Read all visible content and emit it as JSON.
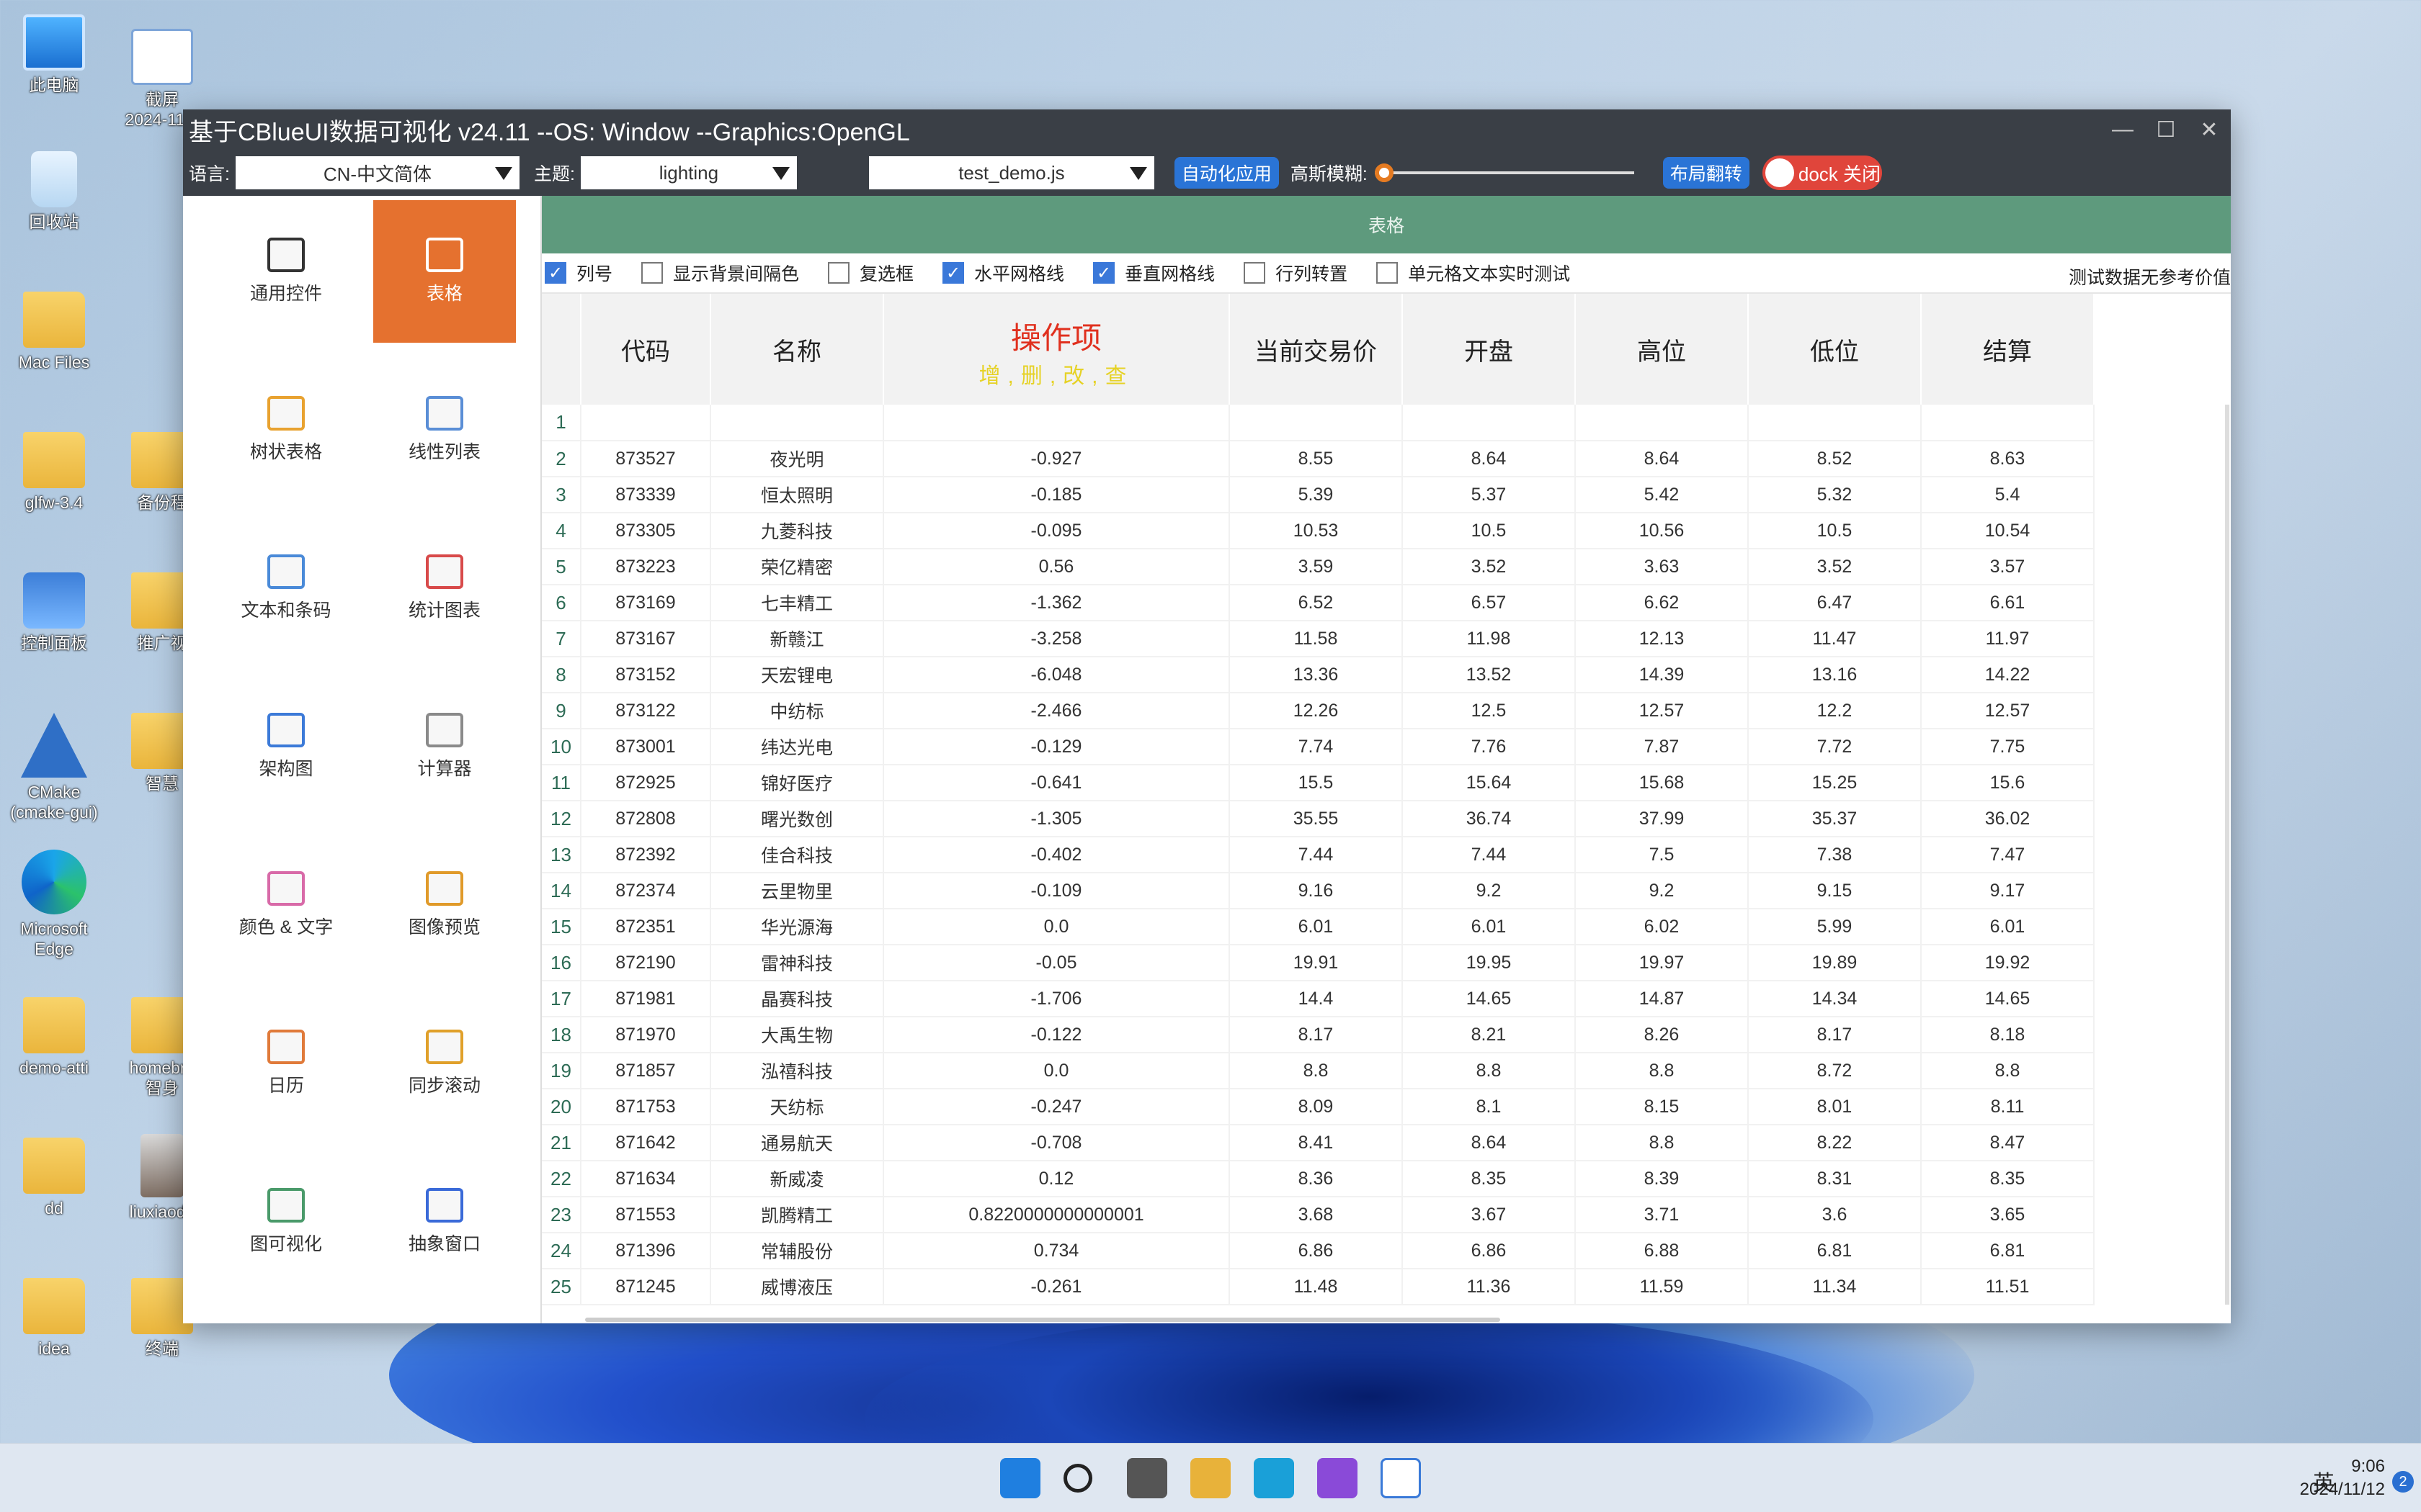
{
  "desktop": {
    "icons": [
      {
        "label": "此电脑",
        "kind": "pc"
      },
      {
        "label": "截屏\n2024-11-1",
        "kind": "shot"
      },
      {
        "label": "回收站",
        "kind": "bin"
      },
      {
        "label": "Mac Files",
        "kind": "folder"
      },
      {
        "label": "glfw-3.4",
        "kind": "folder"
      },
      {
        "label": "备份程",
        "kind": "folder"
      },
      {
        "label": "控制面板",
        "kind": "panel"
      },
      {
        "label": "推广视",
        "kind": "folder"
      },
      {
        "label": "CMake\n(cmake-gui)",
        "kind": "cmake"
      },
      {
        "label": "智慧",
        "kind": "folder"
      },
      {
        "label": "Microsoft\nEdge",
        "kind": "edge"
      },
      {
        "label": "demo-atti",
        "kind": "folder"
      },
      {
        "label": "homebre\n智身",
        "kind": "folder"
      },
      {
        "label": "dd",
        "kind": "folder"
      },
      {
        "label": "liuxiaodo",
        "kind": "photo"
      },
      {
        "label": "idea",
        "kind": "folder"
      },
      {
        "label": "终端",
        "kind": "folder"
      }
    ]
  },
  "window": {
    "title": "基于CBlueUI数据可视化 v24.11  --OS: Window  --Graphics:OpenGL",
    "controls": {
      "min": "—",
      "max": "☐",
      "close": "✕"
    }
  },
  "toolbar": {
    "lang_label": "语言:",
    "lang_value": "CN-中文简体",
    "theme_label": "主题:",
    "theme_value": "lighting",
    "script_value": "test_demo.js",
    "auto_apply": "自动化应用",
    "blur_label": "高斯模糊:",
    "blur_level": 0,
    "layout_flip": "布局翻转",
    "dock_label": "dock 关闭"
  },
  "sidebar": {
    "items": [
      {
        "label": "通用控件",
        "icon": "code-icon"
      },
      {
        "label": "表格",
        "icon": "table-icon",
        "active": true
      },
      {
        "label": "树状表格",
        "icon": "tree-icon"
      },
      {
        "label": "线性列表",
        "icon": "list-icon"
      },
      {
        "label": "文本和条码",
        "icon": "text-icon"
      },
      {
        "label": "统计图表",
        "icon": "chart-icon"
      },
      {
        "label": "架构图",
        "icon": "layers-icon"
      },
      {
        "label": "计算器",
        "icon": "calculator-icon"
      },
      {
        "label": "颜色 & 文字",
        "icon": "palette-icon"
      },
      {
        "label": "图像预览",
        "icon": "image-icon"
      },
      {
        "label": "日历",
        "icon": "calendar-icon"
      },
      {
        "label": "同步滚动",
        "icon": "sync-icon"
      },
      {
        "label": "图可视化",
        "icon": "graph-icon"
      },
      {
        "label": "抽象窗口",
        "icon": "window-icon"
      }
    ]
  },
  "main": {
    "header": "表格",
    "options": [
      {
        "label": "列号",
        "checked": true
      },
      {
        "label": "显示背景间隔色",
        "checked": false
      },
      {
        "label": "复选框",
        "checked": false
      },
      {
        "label": "水平网格线",
        "checked": true
      },
      {
        "label": "垂直网格线",
        "checked": true
      },
      {
        "label": "行列转置",
        "checked": false
      },
      {
        "label": "单元格文本实时测试",
        "checked": false
      }
    ],
    "note": "测试数据无参考价值",
    "columns": {
      "code": "代码",
      "name": "名称",
      "op": "操作项",
      "op_sub": "增,删,改,查",
      "price": "当前交易价",
      "open": "开盘",
      "high": "高位",
      "low": "低位",
      "settle": "结算"
    },
    "rows": [
      [
        "1",
        "",
        "",
        "",
        "",
        "",
        "",
        "",
        ""
      ],
      [
        "2",
        "873527",
        "夜光明",
        "-0.927",
        "8.55",
        "8.64",
        "8.64",
        "8.52",
        "8.63"
      ],
      [
        "3",
        "873339",
        "恒太照明",
        "-0.185",
        "5.39",
        "5.37",
        "5.42",
        "5.32",
        "5.4"
      ],
      [
        "4",
        "873305",
        "九菱科技",
        "-0.095",
        "10.53",
        "10.5",
        "10.56",
        "10.5",
        "10.54"
      ],
      [
        "5",
        "873223",
        "荣亿精密",
        "0.56",
        "3.59",
        "3.52",
        "3.63",
        "3.52",
        "3.57"
      ],
      [
        "6",
        "873169",
        "七丰精工",
        "-1.362",
        "6.52",
        "6.57",
        "6.62",
        "6.47",
        "6.61"
      ],
      [
        "7",
        "873167",
        "新赣江",
        "-3.258",
        "11.58",
        "11.98",
        "12.13",
        "11.47",
        "11.97"
      ],
      [
        "8",
        "873152",
        "天宏锂电",
        "-6.048",
        "13.36",
        "13.52",
        "14.39",
        "13.16",
        "14.22"
      ],
      [
        "9",
        "873122",
        "中纺标",
        "-2.466",
        "12.26",
        "12.5",
        "12.57",
        "12.2",
        "12.57"
      ],
      [
        "10",
        "873001",
        "纬达光电",
        "-0.129",
        "7.74",
        "7.76",
        "7.87",
        "7.72",
        "7.75"
      ],
      [
        "11",
        "872925",
        "锦好医疗",
        "-0.641",
        "15.5",
        "15.64",
        "15.68",
        "15.25",
        "15.6"
      ],
      [
        "12",
        "872808",
        "曙光数创",
        "-1.305",
        "35.55",
        "36.74",
        "37.99",
        "35.37",
        "36.02"
      ],
      [
        "13",
        "872392",
        "佳合科技",
        "-0.402",
        "7.44",
        "7.44",
        "7.5",
        "7.38",
        "7.47"
      ],
      [
        "14",
        "872374",
        "云里物里",
        "-0.109",
        "9.16",
        "9.2",
        "9.2",
        "9.15",
        "9.17"
      ],
      [
        "15",
        "872351",
        "华光源海",
        "0.0",
        "6.01",
        "6.01",
        "6.02",
        "5.99",
        "6.01"
      ],
      [
        "16",
        "872190",
        "雷神科技",
        "-0.05",
        "19.91",
        "19.95",
        "19.97",
        "19.89",
        "19.92"
      ],
      [
        "17",
        "871981",
        "晶赛科技",
        "-1.706",
        "14.4",
        "14.65",
        "14.87",
        "14.34",
        "14.65"
      ],
      [
        "18",
        "871970",
        "大禹生物",
        "-0.122",
        "8.17",
        "8.21",
        "8.26",
        "8.17",
        "8.18"
      ],
      [
        "19",
        "871857",
        "泓禧科技",
        "0.0",
        "8.8",
        "8.8",
        "8.8",
        "8.72",
        "8.8"
      ],
      [
        "20",
        "871753",
        "天纺标",
        "-0.247",
        "8.09",
        "8.1",
        "8.15",
        "8.01",
        "8.11"
      ],
      [
        "21",
        "871642",
        "通易航天",
        "-0.708",
        "8.41",
        "8.64",
        "8.8",
        "8.22",
        "8.47"
      ],
      [
        "22",
        "871634",
        "新威凌",
        "0.12",
        "8.36",
        "8.35",
        "8.39",
        "8.31",
        "8.35"
      ],
      [
        "23",
        "871553",
        "凯腾精工",
        "0.8220000000000001",
        "3.68",
        "3.67",
        "3.71",
        "3.6",
        "3.65"
      ],
      [
        "24",
        "871396",
        "常辅股份",
        "0.734",
        "6.86",
        "6.86",
        "6.88",
        "6.81",
        "6.81"
      ],
      [
        "25",
        "871245",
        "威博液压",
        "-0.261",
        "11.48",
        "11.36",
        "11.59",
        "11.34",
        "11.51"
      ]
    ]
  },
  "taskbar": {
    "apps": [
      "windows-start-icon",
      "search-icon",
      "task-view-icon",
      "file-explorer-icon",
      "edge-icon",
      "visual-studio-icon",
      "cblueui-app-icon"
    ],
    "ime": "英",
    "time": "9:06",
    "date": "2024/11/12",
    "notifications": "2"
  }
}
